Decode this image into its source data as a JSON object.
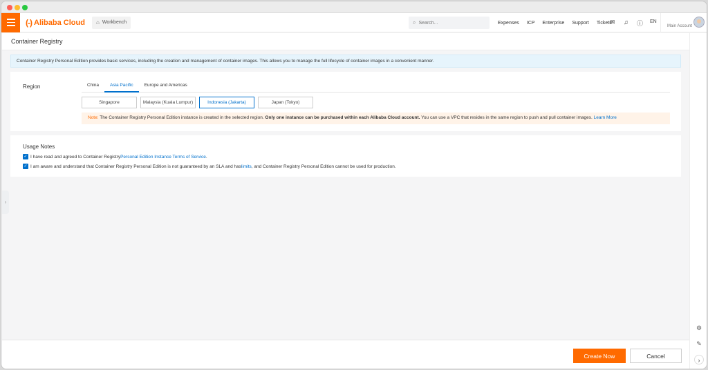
{
  "topnav": {
    "logo_mark": "(-)",
    "logo_text": "Alibaba Cloud",
    "workbench_label": "Workbench",
    "search_placeholder": "Search...",
    "links": [
      "Expenses",
      "ICP",
      "Enterprise",
      "Support",
      "Tickets"
    ],
    "language": "EN",
    "account_label": "Main Account"
  },
  "page": {
    "title": "Container Registry"
  },
  "banner": {
    "text": "Container Registry Personal Edition provides basic services, including the creation and management of container images. This allows you to manage the full lifecycle of container images in a convenient manner."
  },
  "region": {
    "label": "Region",
    "tabs": [
      "China",
      "Asia Pacific",
      "Europe and Americas"
    ],
    "active_tab": "Asia Pacific",
    "options": [
      "Singapore",
      "Malaysia (Kuala Lumpur)",
      "Indonesia (Jakarta)",
      "Japan (Tokyo)"
    ],
    "selected_option": "Indonesia (Jakarta)",
    "note": {
      "label": "Note:",
      "text1": " The Container Registry Personal Edition instance is created in the selected region. ",
      "bold": "Only one instance can be purchased within each Alibaba Cloud account.",
      "text2": " You can use a VPC that resides in the same region to push and pull container images. ",
      "link": "Learn More"
    }
  },
  "usage": {
    "title": "Usage Notes",
    "check1": {
      "text": "I have read and agreed to Container Registry ",
      "link": "Personal Edition Instance Terms of Service",
      "suffix": "."
    },
    "check2": {
      "text": "I am aware and understand that Container Registry Personal Edition is not guaranteed by an SLA and has ",
      "link": "limits",
      "suffix": ", and Container Registry Personal Edition cannot be used for production."
    }
  },
  "footer": {
    "create_label": "Create Now",
    "cancel_label": "Cancel"
  },
  "colors": {
    "brand": "#ff6a00",
    "link": "#0070cc"
  }
}
